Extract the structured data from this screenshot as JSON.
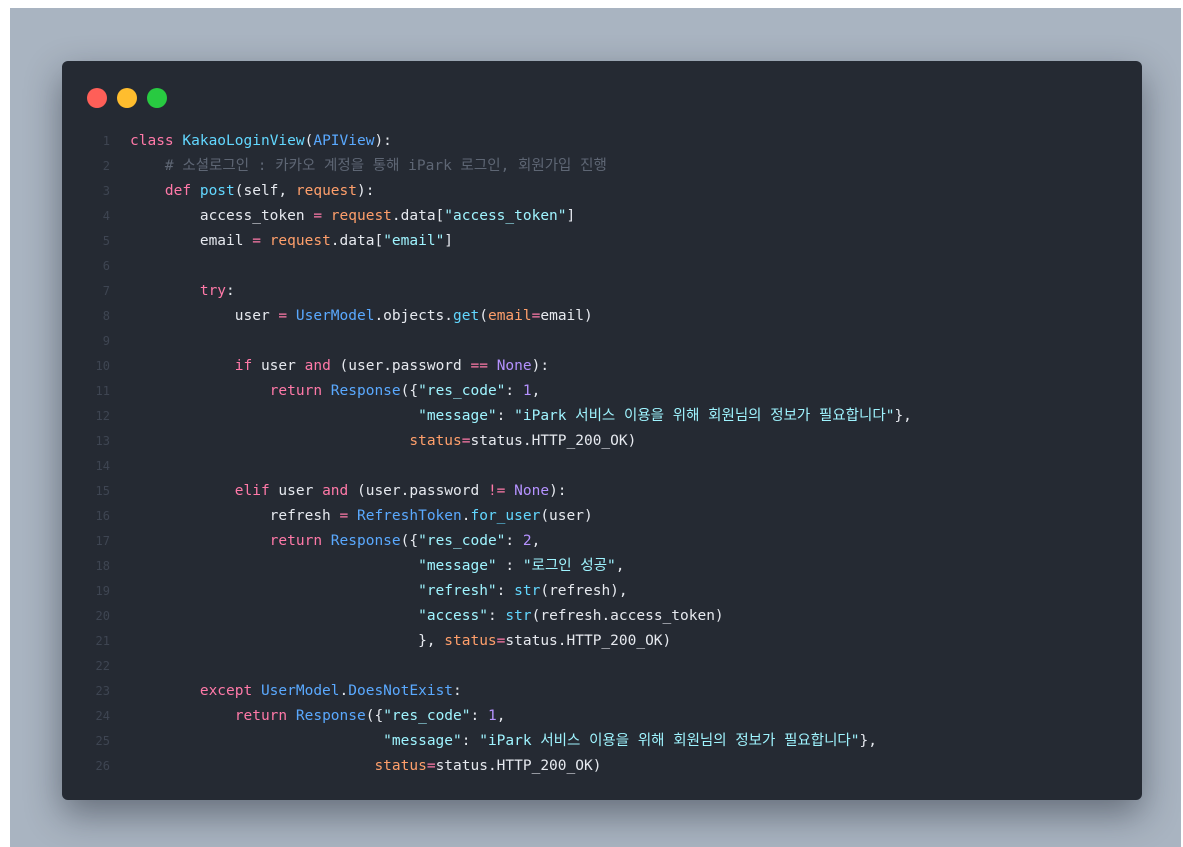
{
  "window": {
    "traffic_lights": [
      "close",
      "minimize",
      "maximize"
    ],
    "colors": {
      "background": "#252a33",
      "keyword": "#ff79a8",
      "function": "#62d7ff",
      "string": "#9ff4ff",
      "comment": "#5e6674",
      "backdrop": "#a9b4c1"
    }
  },
  "code": {
    "language": "python",
    "lines": [
      {
        "n": "1",
        "tokens": [
          [
            "kw",
            "class "
          ],
          [
            "fn",
            "KakaoLoginView"
          ],
          [
            "plain",
            "("
          ],
          [
            "cls",
            "APIView"
          ],
          [
            "plain",
            "):"
          ]
        ]
      },
      {
        "n": "2",
        "tokens": [
          [
            "cm",
            "    # 소셜로그인 : 카카오 계정을 통해 iPark 로그인, 회원가입 진행"
          ]
        ]
      },
      {
        "n": "3",
        "tokens": [
          [
            "kw",
            "    def "
          ],
          [
            "fn",
            "post"
          ],
          [
            "plain",
            "(self, "
          ],
          [
            "param",
            "request"
          ],
          [
            "plain",
            "):"
          ]
        ]
      },
      {
        "n": "4",
        "tokens": [
          [
            "plain",
            "        access_token "
          ],
          [
            "op",
            "="
          ],
          [
            "plain",
            " "
          ],
          [
            "param",
            "request"
          ],
          [
            "plain",
            ".data["
          ],
          [
            "str",
            "\"access_token\""
          ],
          [
            "plain",
            "]"
          ]
        ]
      },
      {
        "n": "5",
        "tokens": [
          [
            "plain",
            "        email "
          ],
          [
            "op",
            "="
          ],
          [
            "plain",
            " "
          ],
          [
            "param",
            "request"
          ],
          [
            "plain",
            ".data["
          ],
          [
            "str",
            "\"email\""
          ],
          [
            "plain",
            "]"
          ]
        ]
      },
      {
        "n": "6",
        "tokens": []
      },
      {
        "n": "7",
        "tokens": [
          [
            "kw",
            "        try"
          ],
          [
            "plain",
            ":"
          ]
        ]
      },
      {
        "n": "8",
        "tokens": [
          [
            "plain",
            "            user "
          ],
          [
            "op",
            "="
          ],
          [
            "plain",
            " "
          ],
          [
            "cls",
            "UserModel"
          ],
          [
            "plain",
            ".objects."
          ],
          [
            "fn",
            "get"
          ],
          [
            "plain",
            "("
          ],
          [
            "param",
            "email"
          ],
          [
            "op",
            "="
          ],
          [
            "plain",
            "email)"
          ]
        ]
      },
      {
        "n": "9",
        "tokens": []
      },
      {
        "n": "10",
        "tokens": [
          [
            "kw",
            "            if "
          ],
          [
            "plain",
            "user "
          ],
          [
            "kw",
            "and"
          ],
          [
            "plain",
            " (user.password "
          ],
          [
            "op",
            "=="
          ],
          [
            "plain",
            " "
          ],
          [
            "num",
            "None"
          ],
          [
            "plain",
            "):"
          ]
        ]
      },
      {
        "n": "11",
        "tokens": [
          [
            "kw",
            "                return "
          ],
          [
            "cls",
            "Response"
          ],
          [
            "plain",
            "({"
          ],
          [
            "str",
            "\"res_code\""
          ],
          [
            "plain",
            ": "
          ],
          [
            "num",
            "1"
          ],
          [
            "plain",
            ","
          ]
        ]
      },
      {
        "n": "12",
        "tokens": [
          [
            "plain",
            "                                 "
          ],
          [
            "str",
            "\"message\""
          ],
          [
            "plain",
            ": "
          ],
          [
            "str",
            "\"iPark 서비스 이용을 위해 회원님의 정보가 필요합니다\""
          ],
          [
            "plain",
            "},"
          ]
        ]
      },
      {
        "n": "13",
        "tokens": [
          [
            "plain",
            "                                "
          ],
          [
            "param",
            "status"
          ],
          [
            "op",
            "="
          ],
          [
            "plain",
            "status.HTTP_200_OK)"
          ]
        ]
      },
      {
        "n": "14",
        "tokens": []
      },
      {
        "n": "15",
        "tokens": [
          [
            "kw",
            "            elif "
          ],
          [
            "plain",
            "user "
          ],
          [
            "kw",
            "and"
          ],
          [
            "plain",
            " (user.password "
          ],
          [
            "op",
            "!="
          ],
          [
            "plain",
            " "
          ],
          [
            "num",
            "None"
          ],
          [
            "plain",
            "):"
          ]
        ]
      },
      {
        "n": "16",
        "tokens": [
          [
            "plain",
            "                refresh "
          ],
          [
            "op",
            "="
          ],
          [
            "plain",
            " "
          ],
          [
            "cls",
            "RefreshToken"
          ],
          [
            "plain",
            "."
          ],
          [
            "fn",
            "for_user"
          ],
          [
            "plain",
            "(user)"
          ]
        ]
      },
      {
        "n": "17",
        "tokens": [
          [
            "kw",
            "                return "
          ],
          [
            "cls",
            "Response"
          ],
          [
            "plain",
            "({"
          ],
          [
            "str",
            "\"res_code\""
          ],
          [
            "plain",
            ": "
          ],
          [
            "num",
            "2"
          ],
          [
            "plain",
            ","
          ]
        ]
      },
      {
        "n": "18",
        "tokens": [
          [
            "plain",
            "                                 "
          ],
          [
            "str",
            "\"message\""
          ],
          [
            "plain",
            " : "
          ],
          [
            "str",
            "\"로그인 성공\""
          ],
          [
            "plain",
            ","
          ]
        ]
      },
      {
        "n": "19",
        "tokens": [
          [
            "plain",
            "                                 "
          ],
          [
            "str",
            "\"refresh\""
          ],
          [
            "plain",
            ": "
          ],
          [
            "fn",
            "str"
          ],
          [
            "plain",
            "(refresh),"
          ]
        ]
      },
      {
        "n": "20",
        "tokens": [
          [
            "plain",
            "                                 "
          ],
          [
            "str",
            "\"access\""
          ],
          [
            "plain",
            ": "
          ],
          [
            "fn",
            "str"
          ],
          [
            "plain",
            "(refresh.access_token)"
          ]
        ]
      },
      {
        "n": "21",
        "tokens": [
          [
            "plain",
            "                                 }, "
          ],
          [
            "param",
            "status"
          ],
          [
            "op",
            "="
          ],
          [
            "plain",
            "status.HTTP_200_OK)"
          ]
        ]
      },
      {
        "n": "22",
        "tokens": []
      },
      {
        "n": "23",
        "tokens": [
          [
            "kw",
            "        except "
          ],
          [
            "cls",
            "UserModel"
          ],
          [
            "plain",
            "."
          ],
          [
            "cls",
            "DoesNotExist"
          ],
          [
            "plain",
            ":"
          ]
        ]
      },
      {
        "n": "24",
        "tokens": [
          [
            "kw",
            "            return "
          ],
          [
            "cls",
            "Response"
          ],
          [
            "plain",
            "({"
          ],
          [
            "str",
            "\"res_code\""
          ],
          [
            "plain",
            ": "
          ],
          [
            "num",
            "1"
          ],
          [
            "plain",
            ","
          ]
        ]
      },
      {
        "n": "25",
        "tokens": [
          [
            "plain",
            "                             "
          ],
          [
            "str",
            "\"message\""
          ],
          [
            "plain",
            ": "
          ],
          [
            "str",
            "\"iPark 서비스 이용을 위해 회원님의 정보가 필요합니다\""
          ],
          [
            "plain",
            "},"
          ]
        ]
      },
      {
        "n": "26",
        "tokens": [
          [
            "plain",
            "                            "
          ],
          [
            "param",
            "status"
          ],
          [
            "op",
            "="
          ],
          [
            "plain",
            "status.HTTP_200_OK)"
          ]
        ]
      }
    ]
  }
}
